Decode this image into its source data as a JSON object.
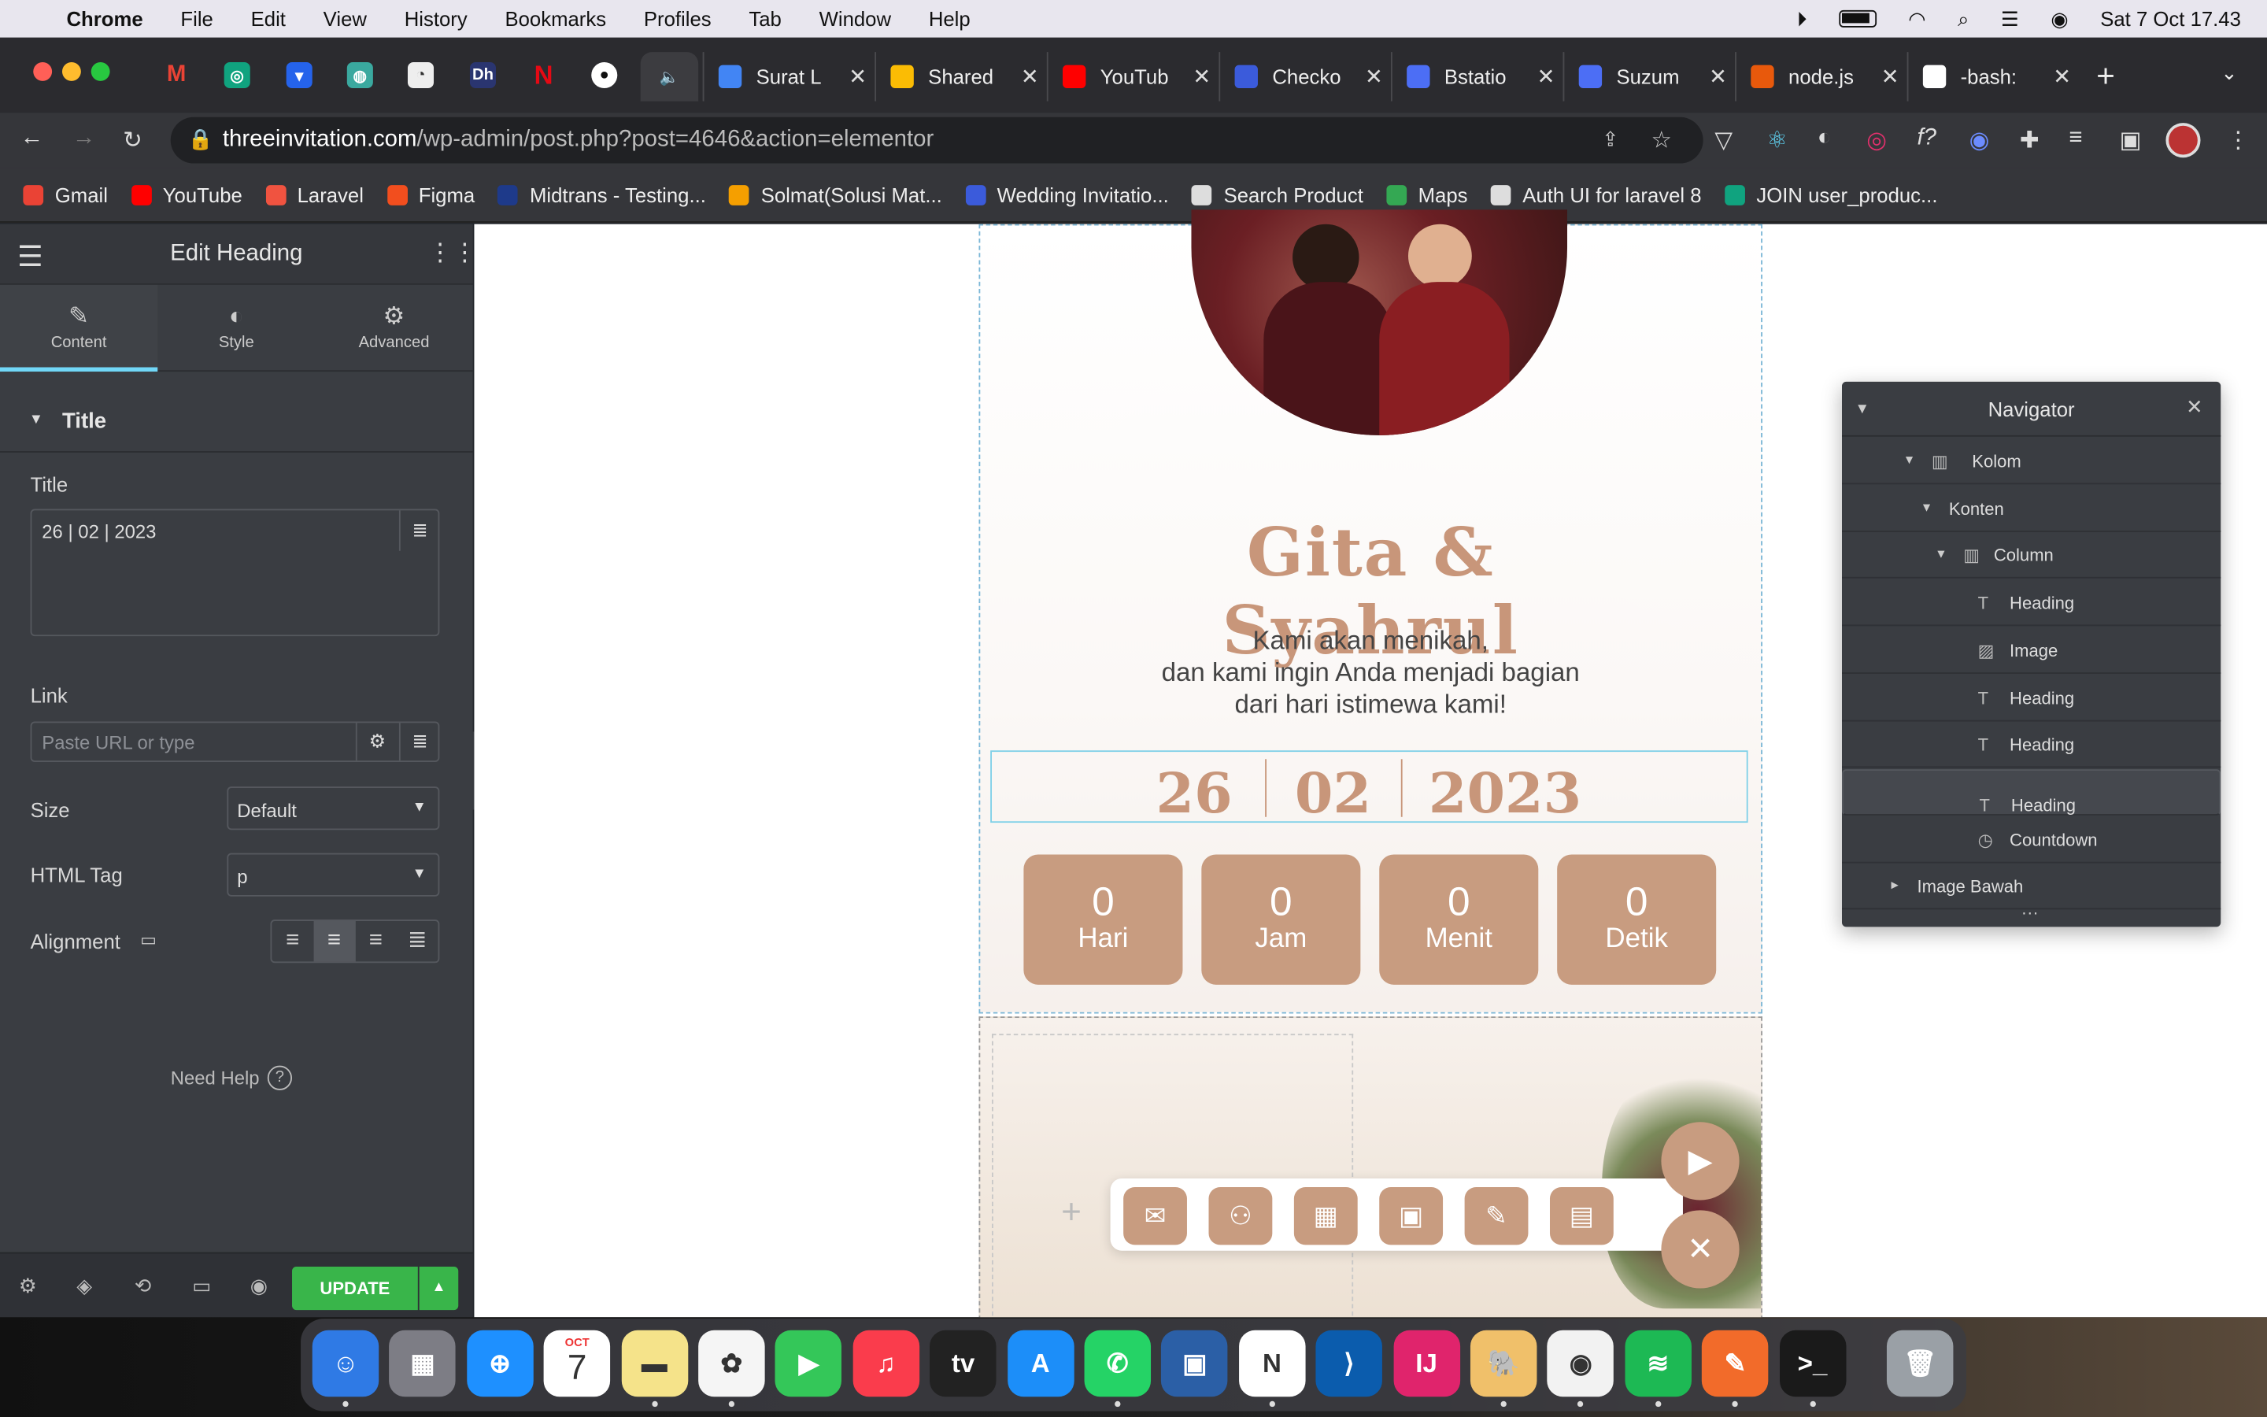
{
  "menubar": {
    "apple": "",
    "app": "Chrome",
    "items": [
      "File",
      "Edit",
      "View",
      "History",
      "Bookmarks",
      "Profiles",
      "Tab",
      "Window",
      "Help"
    ],
    "datetime": "Sat 7 Oct  17.43"
  },
  "tabs": [
    {
      "title": "Surat L",
      "fav": "#4285f4"
    },
    {
      "title": "Shared",
      "fav": "#fbbc04"
    },
    {
      "title": "YouTub",
      "fav": "#ff0000"
    },
    {
      "title": "Checko",
      "fav": "#3b5bdb"
    },
    {
      "title": "Bstatio",
      "fav": "#4c6ef5"
    },
    {
      "title": "Suzum",
      "fav": "#4c6ef5"
    },
    {
      "title": "node.js",
      "fav": "#e8590c"
    },
    {
      "title": "-bash:",
      "fav": "#ffffff"
    }
  ],
  "address": {
    "domain": "threeinvitation.com",
    "path": "/wp-admin/post.php?post=4646&action=elementor"
  },
  "bookmarks": [
    {
      "label": "Gmail",
      "color": "#ea4335"
    },
    {
      "label": "YouTube",
      "color": "#ff0000"
    },
    {
      "label": "Laravel",
      "color": "#f05340"
    },
    {
      "label": "Figma",
      "color": "#f24e1e"
    },
    {
      "label": "Midtrans - Testing...",
      "color": "#1e3a8a"
    },
    {
      "label": "Solmat(Solusi Mat...",
      "color": "#f59f00"
    },
    {
      "label": "Wedding Invitatio...",
      "color": "#3b5bdb"
    },
    {
      "label": "Search Product",
      "color": "#dddddd"
    },
    {
      "label": "Maps",
      "color": "#34a853"
    },
    {
      "label": "Auth UI for laravel 8",
      "color": "#dddddd"
    },
    {
      "label": "JOIN user_produc...",
      "color": "#10a37f"
    }
  ],
  "panel": {
    "title": "Edit Heading",
    "tabs": [
      "Content",
      "Style",
      "Advanced"
    ],
    "section": "Title",
    "title_label": "Title",
    "title_value": "26 | 02 | 2023",
    "link_label": "Link",
    "link_placeholder": "Paste URL or type",
    "size_label": "Size",
    "size_value": "Default",
    "tag_label": "HTML Tag",
    "tag_value": "p",
    "align_label": "Alignment",
    "help": "Need Help",
    "update": "UPDATE"
  },
  "page": {
    "couple": "Gita & Syahrul",
    "intro": [
      "Kami akan menikah,",
      "dan kami ingin Anda menjadi bagian",
      "dari hari istimewa kami!"
    ],
    "date": {
      "day": "26",
      "month": "02",
      "year": "2023"
    },
    "countdown": [
      {
        "value": "0",
        "unit": "Hari"
      },
      {
        "value": "0",
        "unit": "Jam"
      },
      {
        "value": "0",
        "unit": "Menit"
      },
      {
        "value": "0",
        "unit": "Detik"
      }
    ]
  },
  "navigator": {
    "title": "Navigator",
    "rows": [
      {
        "label": "Kolom",
        "icon": "column-icon",
        "arrow": "▾"
      },
      {
        "label": "Konten",
        "icon": "",
        "arrow": "▾"
      },
      {
        "label": "Column",
        "icon": "column-icon",
        "arrow": "▾"
      },
      {
        "label": "Heading",
        "icon": "heading-icon",
        "arrow": ""
      },
      {
        "label": "Image",
        "icon": "image-icon",
        "arrow": ""
      },
      {
        "label": "Heading",
        "icon": "heading-icon",
        "arrow": ""
      },
      {
        "label": "Heading",
        "icon": "heading-icon",
        "arrow": ""
      },
      {
        "label": "Heading",
        "icon": "heading-icon",
        "arrow": "",
        "selected": true
      },
      {
        "label": "Countdown",
        "icon": "countdown-icon",
        "arrow": ""
      },
      {
        "label": "Image Bawah",
        "icon": "",
        "arrow": "▸"
      }
    ]
  },
  "dock": {
    "apps": [
      "Finder",
      "Launchpad",
      "Safari",
      "Calendar",
      "Notes",
      "Photos",
      "FaceTime",
      "Music",
      "Apple TV",
      "App Store",
      "WhatsApp",
      "VirtualBox",
      "Notion",
      "VS Code",
      "IntelliJ IDEA",
      "TablePlus",
      "Chrome",
      "Spotify",
      "Sketch",
      "Terminal",
      "Trash"
    ],
    "calendar_month": "OCT",
    "calendar_day": "7"
  }
}
